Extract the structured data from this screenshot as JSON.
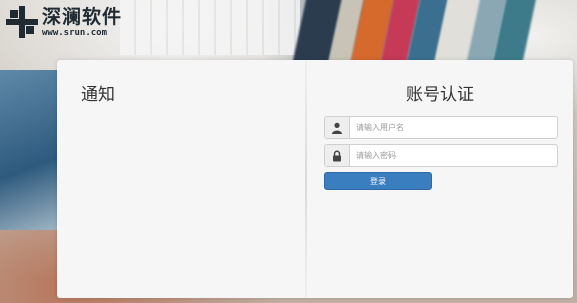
{
  "logo": {
    "title": "深澜软件",
    "url": "www.srun.com"
  },
  "notice": {
    "title": "通知"
  },
  "auth": {
    "title": "账号认证",
    "username_placeholder": "请输入用户名",
    "password_placeholder": "请输入密码",
    "login_label": "登录"
  },
  "icons": {
    "user": "user-icon",
    "lock": "lock-icon"
  },
  "colors": {
    "button": "#3a7ec0",
    "panel": "#f6f6f6"
  }
}
